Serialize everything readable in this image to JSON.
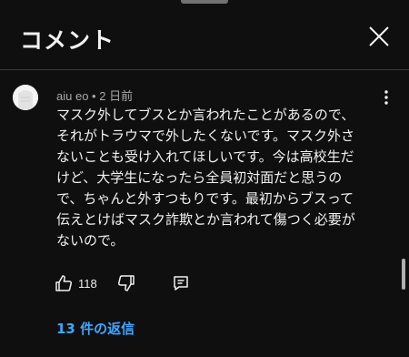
{
  "header": {
    "title": "コメント"
  },
  "comment": {
    "author": "aiu eo",
    "separator": "•",
    "time": "2 日前",
    "text": "マスク外してブスとか言われたことがあるので、\nそれがトラウマで外したくないです。マスク外さ\nないことも受け入れてほしいです。今は高校生だ\nけど、大学生になったら全員初対面だと思うの\nで、ちゃんと外すつもりです。最初からブスって\n伝えとけばマスク詐欺とか言われて傷つく必要が\nないので。",
    "likes": "118",
    "replies_label": "13 件の返信"
  },
  "icons": {
    "close": "close-icon",
    "more": "more-vert-icon",
    "like": "thumbs-up-icon",
    "dislike": "thumbs-down-icon",
    "reply": "comment-icon"
  },
  "colors": {
    "background": "#0f0f0f",
    "text": "#f1f1f1",
    "muted": "#aaaaaa",
    "link": "#3ea6ff"
  }
}
